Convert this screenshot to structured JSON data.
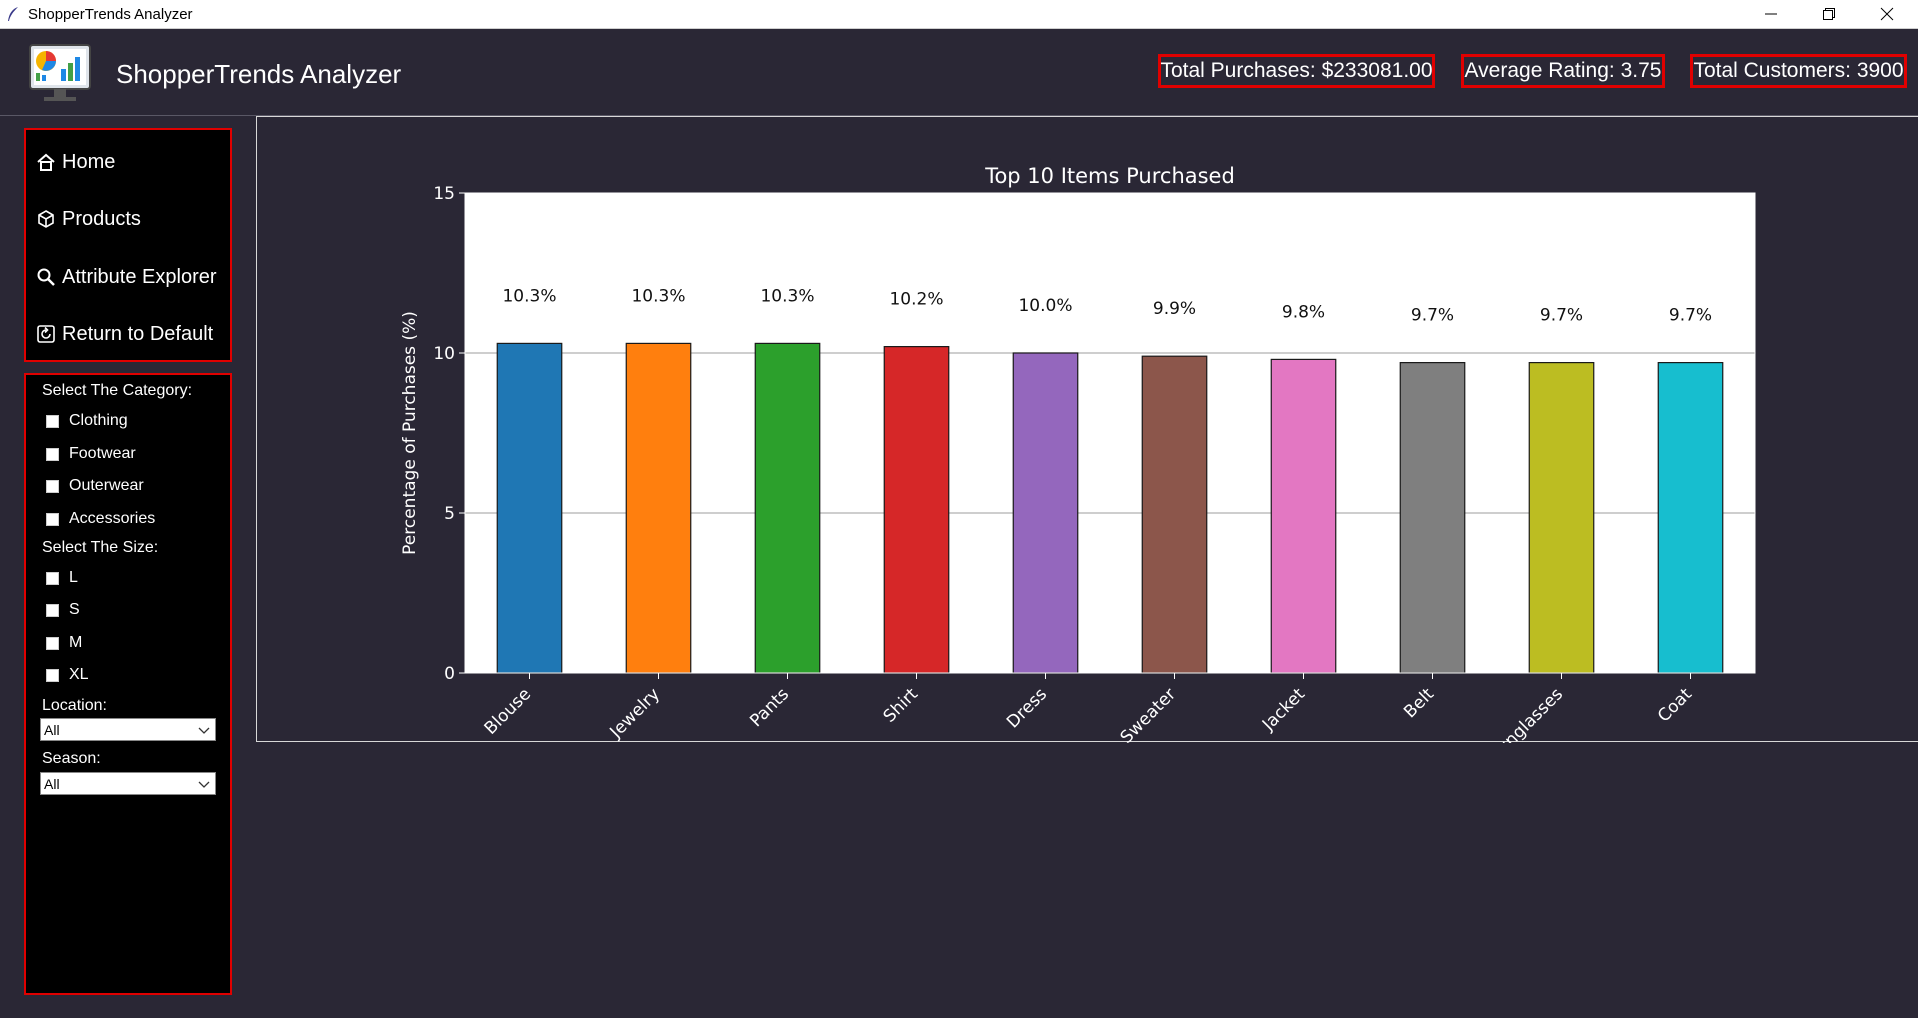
{
  "window": {
    "title": "ShopperTrends Analyzer"
  },
  "header": {
    "app_name": "ShopperTrends Analyzer",
    "logo_icon": "dashboard-monitor-icon",
    "stats": {
      "total_purchases": "Total Purchases: $233081.00",
      "average_rating": "Average Rating: 3.75",
      "total_customers": "Total Customers: 3900"
    }
  },
  "nav": {
    "items": [
      {
        "label": "Home",
        "icon": "home-icon"
      },
      {
        "label": "Products",
        "icon": "box-icon"
      },
      {
        "label": "Attribute Explorer",
        "icon": "search-icon"
      },
      {
        "label": "Return to Default",
        "icon": "reset-icon"
      }
    ]
  },
  "filters": {
    "category_label": "Select The Category:",
    "categories": [
      "Clothing",
      "Footwear",
      "Outerwear",
      "Accessories"
    ],
    "size_label": "Select The Size:",
    "sizes": [
      "L",
      "S",
      "M",
      "XL"
    ],
    "location_label": "Location:",
    "location_value": "All",
    "season_label": "Season:",
    "season_value": "All"
  },
  "chart_data": {
    "type": "bar",
    "title": "Top 10 Items Purchased",
    "xlabel": "",
    "ylabel": "Percentage of Purchases (%)",
    "ylim": [
      0,
      15
    ],
    "yticks": [
      0,
      5,
      10,
      15
    ],
    "grid": "y",
    "categories": [
      "Blouse",
      "Jewelry",
      "Pants",
      "Shirt",
      "Dress",
      "Sweater",
      "Jacket",
      "Belt",
      "Sunglasses",
      "Coat"
    ],
    "values": [
      10.3,
      10.3,
      10.3,
      10.2,
      10.0,
      9.9,
      9.8,
      9.7,
      9.7,
      9.7
    ],
    "data_labels": [
      "10.3%",
      "10.3%",
      "10.3%",
      "10.2%",
      "10.0%",
      "9.9%",
      "9.8%",
      "9.7%",
      "9.7%",
      "9.7%"
    ],
    "colors": [
      "#1f77b4",
      "#ff7f0e",
      "#2ca02c",
      "#d62728",
      "#9467bd",
      "#8c564b",
      "#e377c2",
      "#7f7f7f",
      "#bcbd22",
      "#17becf"
    ]
  }
}
